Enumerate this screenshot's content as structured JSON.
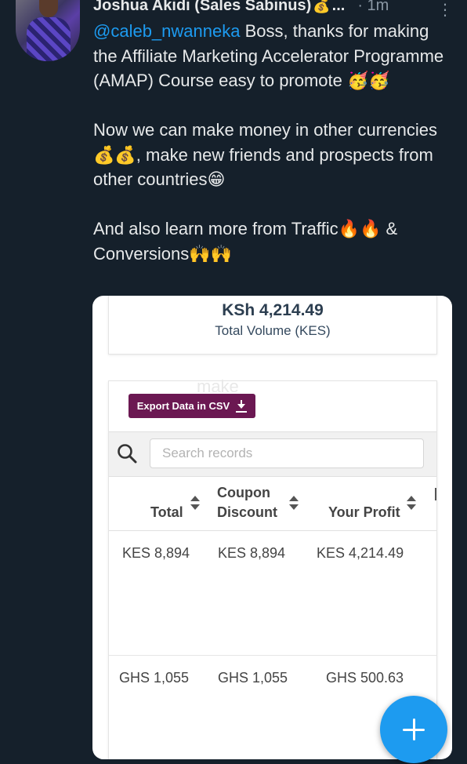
{
  "tweet": {
    "author_name": "Joshua Akidi (Sales Sabinus)",
    "author_emoji": "💰",
    "name_ellipsis": "...",
    "time": "· 1m",
    "more": "⋮",
    "mention": "@caleb_nwanneka",
    "line1": " Boss, thanks for making the Affiliate Marketing Accelerator Programme (AMAP) Course easy to promote 🥳🥳",
    "line2": "Now we can make money in other currencies💰💰, make new friends and prospects from other countries😁",
    "line3": "And also learn more from Traffic🔥🔥 & Conversions🙌🙌"
  },
  "card": {
    "volume_amount": "KSh 4,214.49",
    "volume_label": "Total Volume (KES)",
    "watermark": "make",
    "export_label": "Export Data in CSV",
    "search_placeholder": "Search records",
    "columns": [
      {
        "line1": "",
        "line2": "Total"
      },
      {
        "line1": "Coupon",
        "line2": "Discount"
      },
      {
        "line1": "",
        "line2": "Your Profit"
      }
    ],
    "rows": [
      {
        "total": "KES 8,894",
        "discount": "KES 8,894",
        "profit": "KES 4,214.49"
      },
      {
        "total": "GHS 1,055",
        "discount": "GHS 1,055",
        "profit": "GHS 500.63"
      }
    ]
  },
  "colors": {
    "background": "#15202b",
    "accent": "#1d9bf0",
    "export_button": "#6b1852"
  }
}
